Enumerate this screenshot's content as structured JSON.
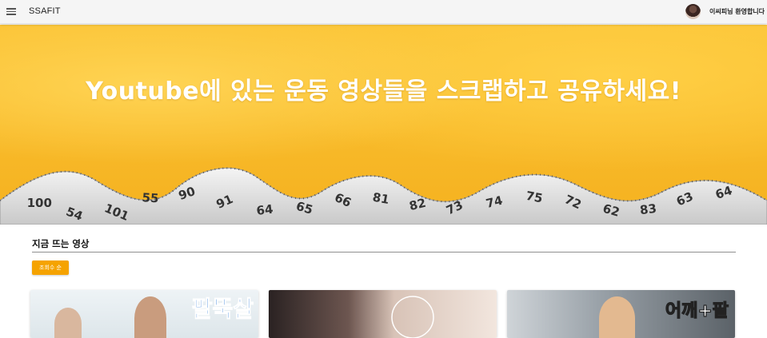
{
  "header": {
    "brand": "SSAFIT",
    "welcome": "이씨피님 환영합니다"
  },
  "hero": {
    "title": "Youtube에 있는 운동 영상들을 스크랩하고 공유하세요!"
  },
  "trending": {
    "title": "지금 뜨는 영상",
    "sort_label": "조회수 순"
  },
  "videos": [
    {
      "thumb_text": "팔뚝살"
    },
    {
      "thumb_text": ""
    },
    {
      "thumb_text": "어깨+팔"
    }
  ],
  "tape_numbers": [
    "100",
    "54",
    "101",
    "55",
    "90",
    "91",
    "64",
    "65",
    "66",
    "81",
    "82",
    "73",
    "74",
    "75",
    "72",
    "62",
    "83",
    "63",
    "64"
  ]
}
